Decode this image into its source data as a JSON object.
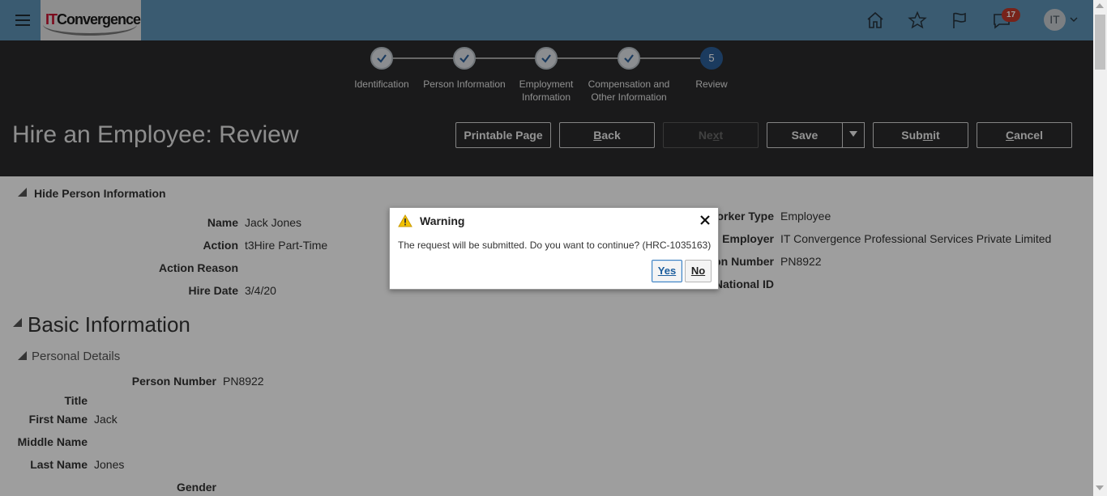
{
  "topbar": {
    "logo_it": "IT",
    "logo_rest": "Convergence",
    "notifications_count": "17",
    "avatar_initials": "IT"
  },
  "train": {
    "steps": [
      {
        "label_line1": "Identification",
        "label_line2": "",
        "state": "done"
      },
      {
        "label_line1": "Person Information",
        "label_line2": "",
        "state": "done"
      },
      {
        "label_line1": "Employment",
        "label_line2": "Information",
        "state": "done"
      },
      {
        "label_line1": "Compensation and",
        "label_line2": "Other Information",
        "state": "done"
      },
      {
        "label_line1": "Review",
        "label_line2": "",
        "state": "current",
        "number": "5"
      }
    ]
  },
  "header": {
    "title": "Hire an Employee: Review",
    "buttons": {
      "printable": "Printable Page",
      "back_pre": "",
      "back_u": "B",
      "back_post": "ack",
      "next_pre": "Ne",
      "next_u": "x",
      "next_post": "t",
      "save": "Save",
      "submit_pre": "Sub",
      "submit_u": "m",
      "submit_post": "it",
      "cancel_pre": "",
      "cancel_u": "C",
      "cancel_post": "ancel"
    }
  },
  "person_info": {
    "section_label": "Hide Person Information",
    "left": [
      {
        "label": "Name",
        "value": "Jack Jones"
      },
      {
        "label": "Action",
        "value": "t3Hire Part-Time"
      },
      {
        "label": "Action Reason",
        "value": ""
      },
      {
        "label": "Hire Date",
        "value": "3/4/20"
      }
    ],
    "right": [
      {
        "label": "orker Type",
        "value": "Employee"
      },
      {
        "label": "l Employer",
        "value": "IT Convergence Professional Services Private Limited"
      },
      {
        "label": "on Number",
        "value": "PN8922"
      },
      {
        "label": "National ID",
        "value": ""
      }
    ]
  },
  "basic_info": {
    "title": "Basic Information",
    "personal_details": "Personal Details",
    "person_number_label": "Person Number",
    "person_number": "PN8922",
    "fields": [
      {
        "label": "Title",
        "value": ""
      },
      {
        "label": "First Name",
        "value": "Jack"
      },
      {
        "label": "Middle Name",
        "value": ""
      },
      {
        "label": "Last Name",
        "value": "Jones"
      }
    ],
    "gender_label": "Gender"
  },
  "dialog": {
    "title": "Warning",
    "message": "The request will be submitted. Do you want to continue? (HRC-1035163)",
    "yes": "Yes",
    "no": "No"
  }
}
